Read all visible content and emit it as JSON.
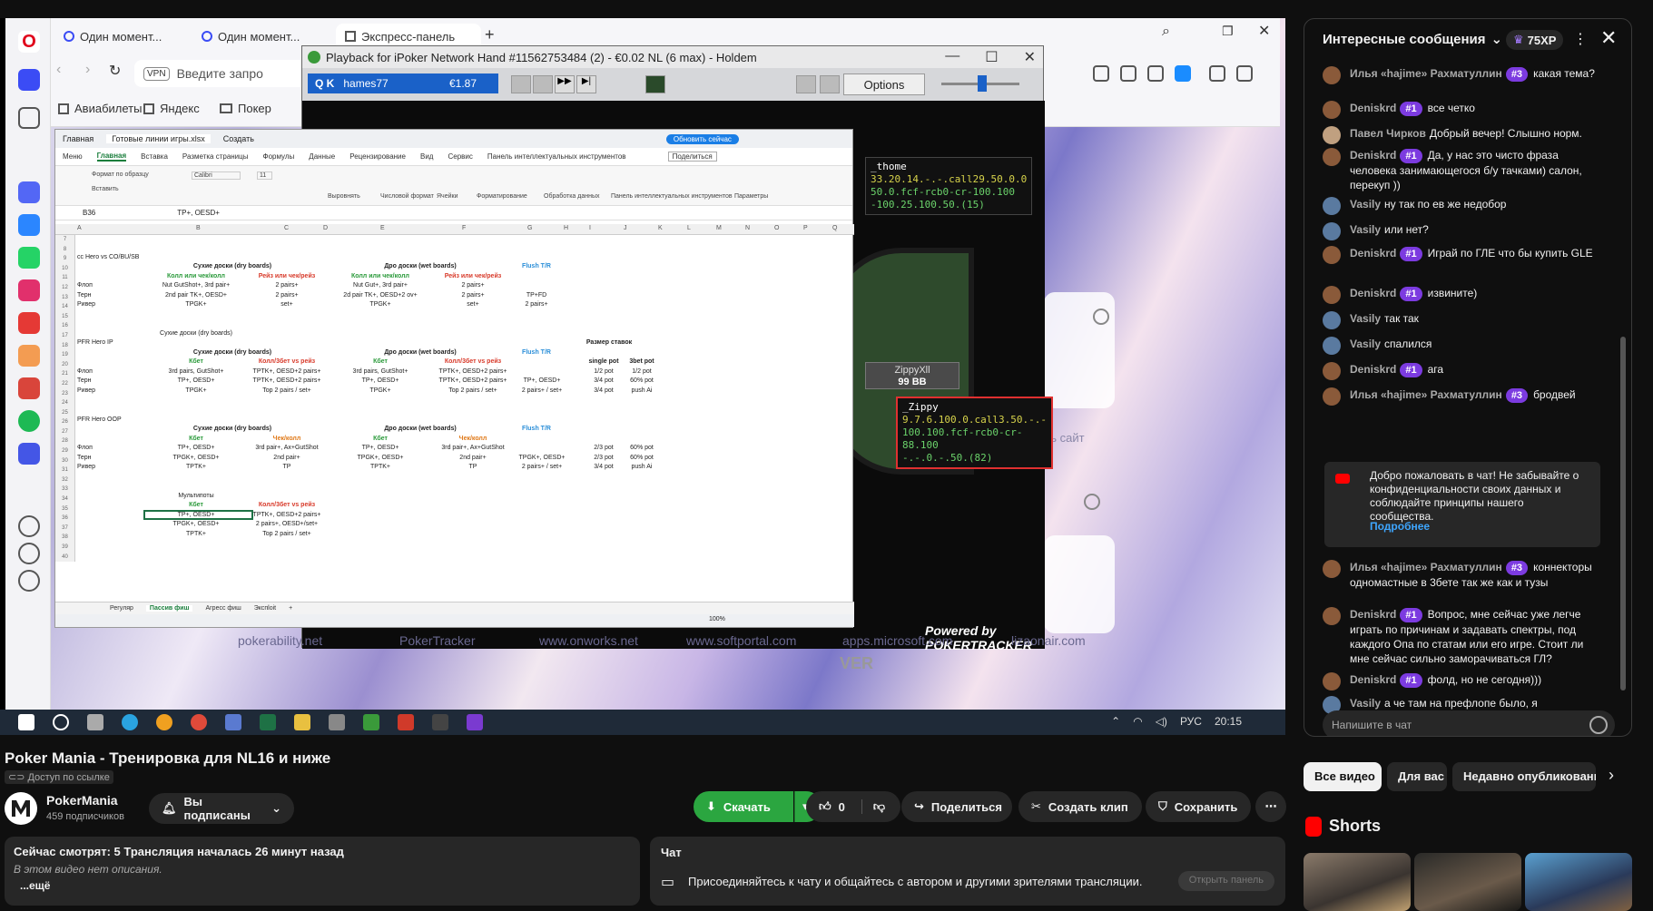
{
  "player": {
    "browser": {
      "tabs": [
        "Один момент...",
        "Один момент...",
        "Экспресс-панель"
      ],
      "address_placeholder": "Введите запро",
      "vpn": "VPN",
      "bookmarks": [
        "Авиабилеты",
        "Яндекс",
        "Покер"
      ]
    },
    "playback": {
      "title": "Playback for iPoker Network Hand #11562753484 (2) - €0.02 NL (6 max) - Holdem",
      "player_select": "hames77",
      "player_amount": "€1.87",
      "options": "Options",
      "hud_top": {
        "name": "_thome",
        "l1": "33.20.14.-.-.call29.50.0.0",
        "l2": "50.0.fcf-rcb0-cr-100.100",
        "l3": "-100.25.100.50.(15)"
      },
      "seat": {
        "name": "ZippyXll",
        "stack": "99 BB"
      },
      "hud_bottom": {
        "name": "_Zippy",
        "l1": "9.7.6.100.0.call3.50.-.-",
        "l2": "100.100.fcf-rcb0-cr-88.100",
        "l3": "-.-.0.-.50.(82)"
      },
      "powered": "Powered by POKERTRACKER",
      "ver": "VER"
    },
    "excel": {
      "top_tabs": [
        "Главная",
        "Готовые линии игры.xlsx",
        "Создать"
      ],
      "update_btn": "Обновить сейчас",
      "menu": [
        "Меню",
        "Главная",
        "Вставка",
        "Разметка страницы",
        "Формулы",
        "Данные",
        "Рецензирование",
        "Вид",
        "Сервис",
        "Панель интеллектуальных инструментов"
      ],
      "share": "Поделиться",
      "cell_ref": "B36",
      "formula": "TP+, OESD+",
      "font": "Calibri",
      "font_size": "11",
      "ribbon": [
        "Формат по образцу",
        "Вставить",
        "Выровнять",
        "Числовой формат",
        "Ячейки",
        "Форматирование",
        "Обработка данных",
        "Панель интеллектуальных инструментов",
        "Параметры"
      ],
      "cols": [
        "A",
        "B",
        "C",
        "D",
        "E",
        "F",
        "G",
        "H",
        "I",
        "J",
        "K",
        "L",
        "M",
        "N",
        "O",
        "P",
        "Q"
      ],
      "rows": [
        "7",
        "8",
        "9",
        "10",
        "11",
        "12",
        "13",
        "14",
        "15",
        "16",
        "17",
        "18",
        "19",
        "20",
        "21",
        "22",
        "23",
        "24",
        "25",
        "26",
        "27",
        "28",
        "29",
        "30",
        "31",
        "32",
        "33",
        "34",
        "35",
        "36",
        "37",
        "38",
        "39",
        "40"
      ],
      "cells": {
        "r9": "cc Hero vs CO/BU/SB",
        "dry": "Сухие доски (dry boards)",
        "wet": "Дро доски (wet boards)",
        "flush": "Flush T/R",
        "callbet": "Колл или чек/колл",
        "raise": "Рейз или чек/рейз",
        "flop": "Флоп",
        "turn": "Терн",
        "river": "Ривер",
        "r12b": "Nut GutShot+, 3rd pair+",
        "r12c": "2 pairs+",
        "r12e": "Nut Gut+, 3rd pair+",
        "r12f": "2 pairs+",
        "r13b": "2nd pair TK+, OESD+",
        "r13c": "2 pairs+",
        "r13e": "2d pair TK+, OESD+2 ov+",
        "r13f": "2 pairs+",
        "r13g": "TP+FD",
        "r14b": "TPGK+",
        "r14c": "set+",
        "r14e": "TPGK+",
        "r14f": "set+",
        "r14g": "2 pairs+",
        "r17": "Сухие доски (dry boards)",
        "r18": "PFR Hero IP",
        "size": "Размер ставок",
        "kbet": "Кбет",
        "kollbet": "Колл/3бет vs рейз",
        "single": "single pot",
        "threebet": "3bet pot",
        "r21b": "3rd pairs, GutShot+",
        "r21c": "TPTK+, OESD+2 pairs+",
        "r21e": "3rd pairs, GutShot+",
        "r21f": "TPTK+, OESD+2 pairs+",
        "r21i": "1/2 pot",
        "r21j": "1/2 pot",
        "r22b": "TP+, OESD+",
        "r22c": "TPTK+, OESD+2 pairs+",
        "r22e": "TP+, OESD+",
        "r22f": "TPTK+, OESD+2 pairs+",
        "r22g": "TP+, OESD+",
        "r22i": "3/4 pot",
        "r22j": "60% pot",
        "r23b": "TPGK+",
        "r23c": "Top 2 pairs / set+",
        "r23e": "TPGK+",
        "r23f": "Top 2 pairs / set+",
        "r23g": "2 pairs+ / set+",
        "r23i": "3/4 pot",
        "r23j": "push Ai",
        "r26": "PFR Hero OOP",
        "chk": "Чек/колл",
        "r29b": "TP+, OESD+",
        "r29c": "3rd pair+, Ax+GutShot",
        "r29e": "TP+, OESD+",
        "r29f": "3rd pair+, Ax+GutShot",
        "r29i": "2/3 pot",
        "r29j": "60% pot",
        "r30b": "TPGK+, OESD+",
        "r30c": "2nd pair+",
        "r30e": "TPGK+, OESD+",
        "r30f": "2nd pair+",
        "r30g": "TPGK+, OESD+",
        "r30i": "2/3 pot",
        "r30j": "60% pot",
        "r31b": "TPTK+",
        "r31c": "TP",
        "r31e": "TPTK+",
        "r31f": "TP",
        "r31g": "2 pairs+ / set+",
        "r31i": "3/4 pot",
        "r31j": "push Ai",
        "r34": "Мультипоты",
        "r36b": "TP+, OESD+",
        "r36c": "TPTK+, OESD+2 pairs+",
        "r37b": "TPGK+, OESD+",
        "r37c": "2 pairs+, OESD+/set+",
        "r38b": "TPTK+",
        "r38c": "Top 2 pairs / set+"
      },
      "sheets": [
        "Регуляр",
        "Пассив фиш",
        "Агресс фиш",
        "Экспloit"
      ],
      "zoom": "100%"
    },
    "sites": [
      "pokerability.net",
      "PokerTracker",
      "www.onworks.net",
      "www.softportal.com",
      "apps.microsoft.com",
      "lizaonair.com"
    ],
    "tile_text": "ить сайт",
    "taskbar": {
      "lang": "РУС",
      "time": "20:15"
    }
  },
  "video": {
    "title": "Poker Mania - Тренировка для NL16 и ниже",
    "visibility": "Доступ по ссылке",
    "channel": "PokerMania",
    "subscribers": "459 подписчиков",
    "subscribe": "Вы подписаны",
    "download": "Скачать",
    "likes": "0",
    "share": "Поделиться",
    "clip": "Создать клип",
    "save": "Сохранить"
  },
  "description": {
    "stats": "Сейчас смотрят: 5  Трансляция началась 26 минут назад",
    "empty": "В этом видео нет описания.",
    "more": "...ещё"
  },
  "chat_promo": {
    "title": "Чат",
    "text": "Присоединяйтесь к чату и общайтесь с автором и другими зрителями трансляции.",
    "open": "Открыть панель"
  },
  "chat": {
    "header": "Интересные сообщения",
    "xp": "75XP",
    "messages": [
      {
        "author": "Илья «hajime» Рахматуллин",
        "badge": "#3",
        "text": "какая тема?"
      },
      {
        "author": "Deniskrd",
        "badge": "#1",
        "text": "все четко"
      },
      {
        "author": "Павел Чирков",
        "badge": "",
        "text": "Добрый вечер! Слышно норм."
      },
      {
        "author": "Deniskrd",
        "badge": "#1",
        "text": "Да, у нас это чисто фраза человека занимающегося б/у тачками) салон, перекуп ))"
      },
      {
        "author": "Vasily",
        "badge": "",
        "text": "ну так по ев же недобор"
      },
      {
        "author": "Vasily",
        "badge": "",
        "text": "или нет?"
      },
      {
        "author": "Deniskrd",
        "badge": "#1",
        "text": "Играй по ГЛЕ что бы купить GLE"
      },
      {
        "author": "Deniskrd",
        "badge": "#1",
        "text": "извините)"
      },
      {
        "author": "Vasily",
        "badge": "",
        "text": "так так"
      },
      {
        "author": "Vasily",
        "badge": "",
        "text": "спалился"
      },
      {
        "author": "Deniskrd",
        "badge": "#1",
        "text": "ага"
      },
      {
        "author": "Илья «hajime» Рахматуллин",
        "badge": "#3",
        "text": "бродвей"
      },
      {
        "author": "Илья «hajime» Рахматуллин",
        "badge": "#3",
        "text": "коннекторы одномастные в 3бете так же как и тузы"
      },
      {
        "author": "Deniskrd",
        "badge": "#1",
        "text": "Вопрос, мне сейчас уже легче играть по причинам и задавать спектры, под каждого Опа по статам или его игре. Стоит ли мне сейчас сильно заморачиваться ГЛ?"
      },
      {
        "author": "Deniskrd",
        "badge": "#1",
        "text": "фолд, но не сегодня)))"
      },
      {
        "author": "Vasily",
        "badge": "",
        "text": "а че там на префлопе было, я пропустил?)"
      }
    ],
    "notice": "Добро пожаловать в чат! Не забывайте о конфиденциальности своих данных и соблюдайте принципы нашего сообщества.",
    "notice_more": "Подробнее",
    "input_placeholder": "Напишите в чат"
  },
  "chips": [
    "Все видео",
    "Для вас",
    "Недавно опубликованные"
  ],
  "shorts_title": "Shorts"
}
